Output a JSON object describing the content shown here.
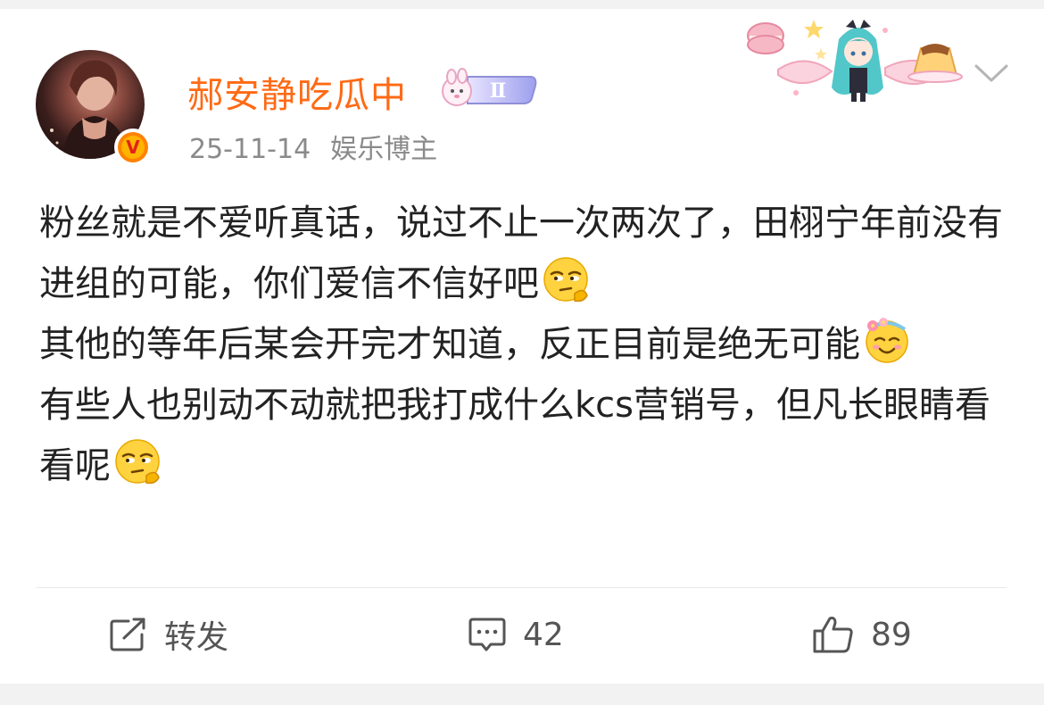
{
  "post": {
    "username": "郝安静吃瓜中",
    "date": "25-11-14",
    "category": "娱乐博主",
    "level_badge": "Ⅱ",
    "verified_mark": "V",
    "paragraphs": [
      "粉丝就是不爱听真话，说过不止一次两次了，田栩宁年前没有进组的可能，你们爱信不信好吧",
      "其他的等年后某会开完才知道，反正目前是绝无可能",
      "有些人也别动不动就把我打成什么kcs营销号，但凡长眼睛看看呢"
    ],
    "emoji": [
      "thinking-side-eye-emoji",
      "flower-crown-smile-emoji",
      "thinking-side-eye-emoji"
    ]
  },
  "actions": {
    "repost_label": "转发",
    "comment_count": "42",
    "like_count": "89"
  },
  "colors": {
    "username": "#ff6a15",
    "meta": "#8a8a8a",
    "body_text": "#222222",
    "background": "#f2f2f2"
  }
}
